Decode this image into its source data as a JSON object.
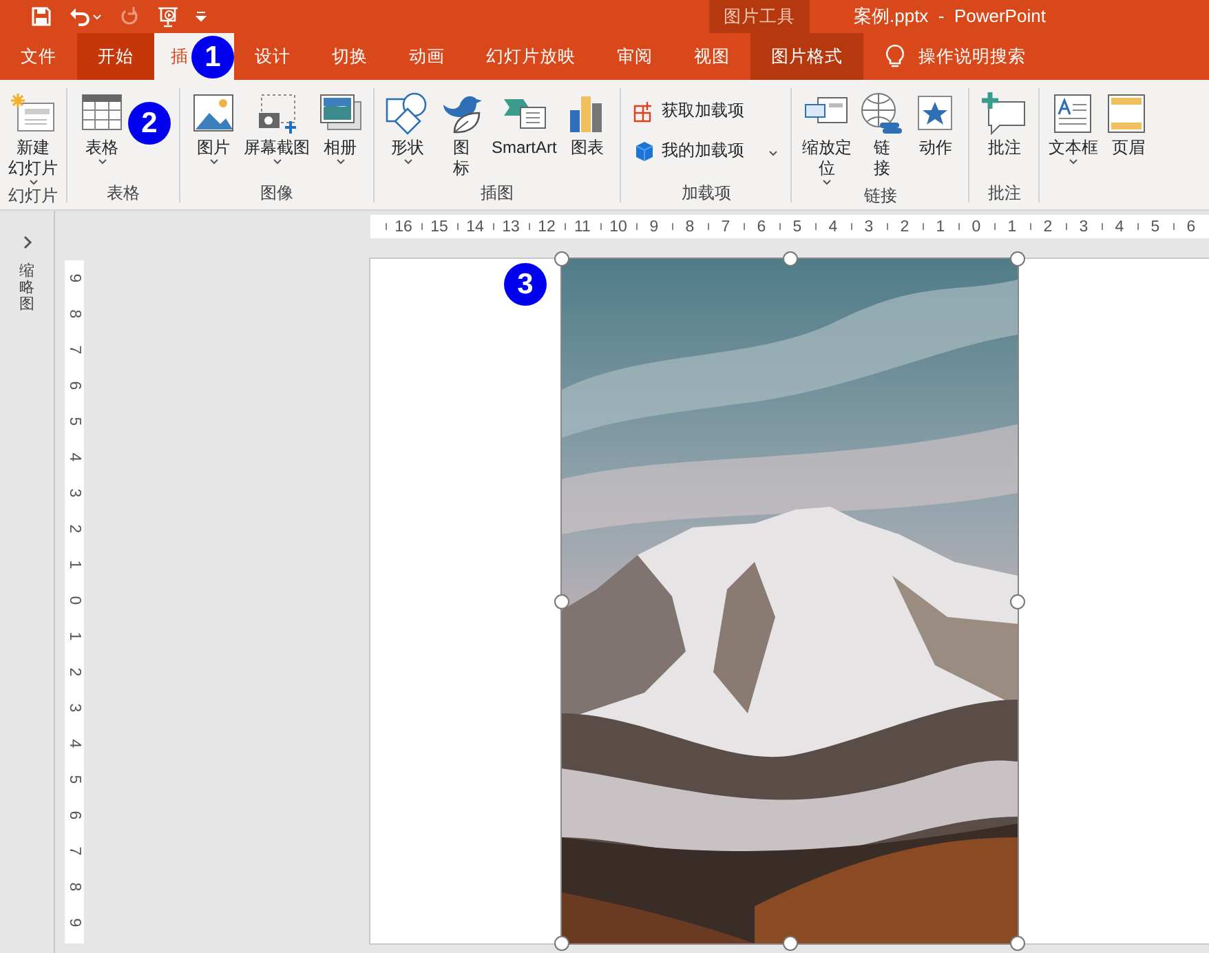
{
  "quick_access": [
    {
      "kind": "save",
      "disabled": false,
      "dropdown": false
    },
    {
      "kind": "undo",
      "disabled": false,
      "dropdown": true
    },
    {
      "kind": "redo",
      "disabled": true,
      "dropdown": false
    },
    {
      "kind": "slideshow",
      "disabled": false,
      "dropdown": false
    },
    {
      "kind": "customize",
      "disabled": false,
      "dropdown": false
    }
  ],
  "context_group": "图片工具",
  "window_title": "案例.pptx  -  PowerPoint",
  "tabs": [
    {
      "label": "文件",
      "kind": "file",
      "selected": false,
      "hovered": false
    },
    {
      "label": "开始",
      "kind": "normal",
      "selected": false,
      "hovered": true
    },
    {
      "label": "插",
      "kind": "normal",
      "selected": true,
      "badge": "1"
    },
    {
      "label": "设计",
      "kind": "normal",
      "selected": false,
      "hovered": false
    },
    {
      "label": "切换",
      "kind": "normal",
      "selected": false,
      "hovered": false
    },
    {
      "label": "动画",
      "kind": "normal",
      "selected": false,
      "hovered": false
    },
    {
      "label": "幻灯片放映",
      "kind": "normal",
      "selected": false,
      "hovered": false
    },
    {
      "label": "审阅",
      "kind": "normal",
      "selected": false,
      "hovered": false
    },
    {
      "label": "视图",
      "kind": "normal",
      "selected": false,
      "hovered": false
    },
    {
      "label": "图片格式",
      "kind": "contextual",
      "selected": false
    }
  ],
  "tell_me": "操作说明搜索",
  "ribbon_groups": [
    {
      "label": "幻灯片",
      "items": [
        {
          "kind": "large",
          "lines": [
            "新建",
            "幻灯片"
          ],
          "dropdown": true
        }
      ]
    },
    {
      "label": "表格",
      "items": [
        {
          "kind": "large",
          "lines": [
            "表格"
          ],
          "dropdown": true,
          "badge": "2"
        }
      ]
    },
    {
      "label": "图像",
      "items": [
        {
          "kind": "large",
          "lines": [
            "图片"
          ],
          "dropdown": true
        },
        {
          "kind": "large",
          "lines": [
            "屏幕截图"
          ],
          "dropdown": true
        },
        {
          "kind": "large",
          "lines": [
            "相册"
          ],
          "dropdown": true
        }
      ]
    },
    {
      "label": "插图",
      "items": [
        {
          "kind": "large",
          "lines": [
            "形状"
          ],
          "dropdown": true
        },
        {
          "kind": "large",
          "lines": [
            "图",
            "标"
          ],
          "dropdown": false
        },
        {
          "kind": "large",
          "lines": [
            "SmartArt"
          ],
          "dropdown": false
        },
        {
          "kind": "large",
          "lines": [
            "图表"
          ],
          "dropdown": false
        }
      ]
    },
    {
      "label": "加载项",
      "items": [
        {
          "kind": "small",
          "lines": [
            "获取加载项"
          ],
          "dropdown": false
        },
        {
          "kind": "small",
          "lines": [
            "我的加载项"
          ],
          "dropdown": true
        }
      ]
    },
    {
      "label": "链接",
      "items": [
        {
          "kind": "large",
          "lines": [
            "缩放定",
            "位"
          ],
          "dropdown": true
        },
        {
          "kind": "large",
          "lines": [
            "链",
            "接"
          ],
          "dropdown": false
        },
        {
          "kind": "large",
          "lines": [
            "动作"
          ],
          "dropdown": false
        }
      ]
    },
    {
      "label": "批注",
      "items": [
        {
          "kind": "large",
          "lines": [
            "批注"
          ],
          "dropdown": false
        }
      ]
    },
    {
      "items": [
        {
          "kind": "large",
          "lines": [
            "文本框"
          ],
          "dropdown": true
        },
        {
          "kind": "large",
          "lines": [
            "页眉"
          ],
          "dropdown": false
        }
      ]
    }
  ],
  "thumbnail_pane": {
    "label": "缩略图"
  },
  "ruler_h": [
    "16",
    "15",
    "14",
    "13",
    "12",
    "11",
    "10",
    "9",
    "8",
    "7",
    "6",
    "5",
    "4",
    "3",
    "2",
    "1",
    "0",
    "1",
    "2",
    "3",
    "4",
    "5",
    "6"
  ],
  "ruler_v": [
    "9",
    "8",
    "7",
    "6",
    "5",
    "4",
    "3",
    "2",
    "1",
    "0",
    "1",
    "2",
    "3",
    "4",
    "5",
    "6",
    "7",
    "8",
    "9"
  ],
  "slide": {
    "badge": "3",
    "picture": {
      "kind": "picture",
      "selected": true
    }
  }
}
